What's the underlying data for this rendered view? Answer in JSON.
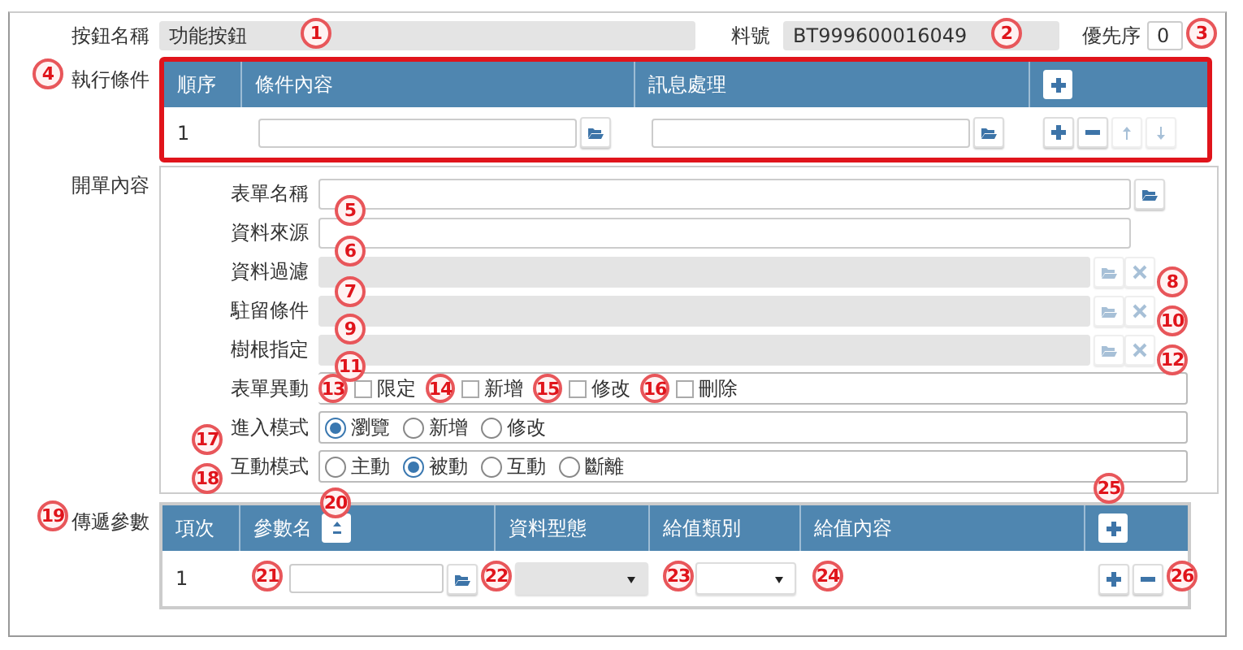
{
  "header": {
    "button_name": {
      "label": "按鈕名稱",
      "value": "功能按鈕"
    },
    "part_no": {
      "label": "料號",
      "value": "BT999600016049"
    },
    "priority": {
      "label": "優先序",
      "value": "0"
    }
  },
  "conditions": {
    "label": "執行條件",
    "columns": [
      "順序",
      "條件內容",
      "訊息處理"
    ],
    "rows": [
      {
        "index": "1",
        "actions": [
          {
            "kind": "add",
            "disabled": false
          },
          {
            "kind": "remove",
            "disabled": false
          },
          {
            "kind": "up",
            "disabled": true
          },
          {
            "kind": "down",
            "disabled": true
          }
        ]
      }
    ]
  },
  "order_content": {
    "label": "開單內容",
    "fields": [
      {
        "kind": "browse",
        "label": "表單名稱",
        "disabled": false
      },
      {
        "kind": "text",
        "label": "資料來源",
        "disabled": false
      },
      {
        "kind": "browse_clear",
        "label": "資料過濾",
        "disabled": true
      },
      {
        "kind": "browse_clear",
        "label": "駐留條件",
        "disabled": true
      },
      {
        "kind": "browse_clear",
        "label": "樹根指定",
        "disabled": true
      }
    ],
    "form_change": {
      "label": "表單異動",
      "options": [
        {
          "label": "限定",
          "checked": false,
          "callout": "13"
        },
        {
          "label": "新增",
          "checked": false,
          "callout": "14"
        },
        {
          "label": "修改",
          "checked": false,
          "callout": "15"
        },
        {
          "label": "刪除",
          "checked": false,
          "callout": "16"
        }
      ]
    },
    "enter_mode": {
      "label": "進入模式",
      "options": [
        {
          "label": "瀏覽",
          "selected": true
        },
        {
          "label": "新增",
          "selected": false
        },
        {
          "label": "修改",
          "selected": false
        }
      ]
    },
    "interact_mode": {
      "label": "互動模式",
      "options": [
        {
          "label": "主動",
          "selected": false
        },
        {
          "label": "被動",
          "selected": true
        },
        {
          "label": "互動",
          "selected": false
        },
        {
          "label": "斷離",
          "selected": false
        }
      ]
    }
  },
  "parameters": {
    "label": "傳遞參數",
    "columns": [
      "項次",
      "參數名",
      "資料型態",
      "給值類別",
      "給值內容"
    ],
    "rows": [
      {
        "index": "1",
        "type_select": {
          "disabled": true
        },
        "value_kind_select": {
          "disabled": false
        }
      }
    ]
  },
  "callouts": [
    "1",
    "2",
    "3",
    "4",
    "5",
    "6",
    "7",
    "8",
    "9",
    "10",
    "11",
    "12",
    "17",
    "18",
    "19",
    "20",
    "21",
    "22",
    "23",
    "24",
    "25",
    "26"
  ]
}
